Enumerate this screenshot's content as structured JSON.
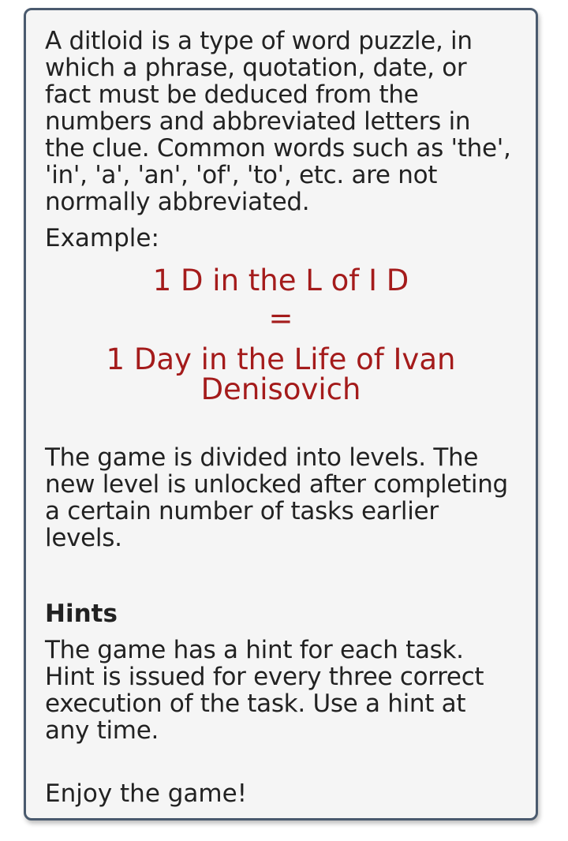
{
  "intro": "A ditloid is a type of word puzzle, in which a phrase, quotation, date, or fact must be deduced from the numbers and abbreviated letters in the clue. Common words such as 'the', 'in', 'a', 'an', 'of', 'to', etc. are not normally abbreviated.",
  "example": {
    "label": "Example:",
    "abbreviated": "1 D in the L of I D",
    "equals": "=",
    "full": "1 Day in the Life of Ivan Denisovich",
    "color": "#a41b1b"
  },
  "levels_text": "The game is divided into levels. The new level is unlocked after completing a certain number of tasks earlier levels.",
  "hints": {
    "title": "Hints",
    "text": "The game has a hint for each task. Hint is issued for every three correct execution of the task. Use a hint at any time."
  },
  "closing": "Enjoy the game!"
}
